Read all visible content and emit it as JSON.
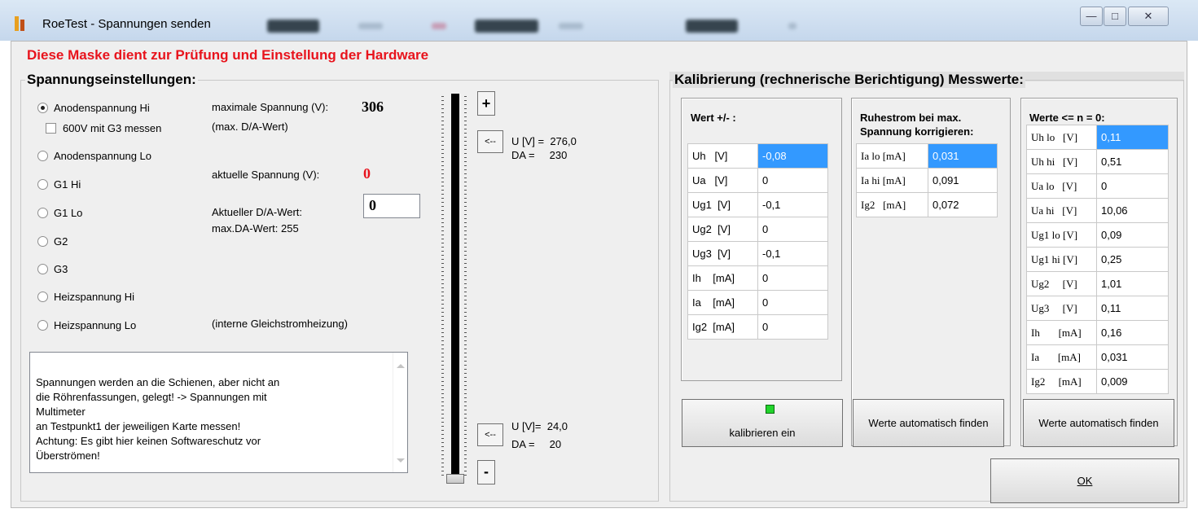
{
  "window": {
    "title": "RoeTest - Spannungen senden",
    "minimize_label": "—",
    "maximize_label": "□",
    "close_label": "✕"
  },
  "warning_text": "Diese Maske dient zur Prüfung und Einstellung der Hardware",
  "voltage_settings": {
    "legend": "Spannungseinstellungen:",
    "radio_options": [
      {
        "label": "Anodenspannung Hi",
        "selected": true
      },
      {
        "label": "Anodenspannung Lo",
        "selected": false
      },
      {
        "label": "G1 Hi",
        "selected": false
      },
      {
        "label": "G1 Lo",
        "selected": false
      },
      {
        "label": "G2",
        "selected": false
      },
      {
        "label": "G3",
        "selected": false
      },
      {
        "label": "Heizspannung Hi",
        "selected": false
      },
      {
        "label": "Heizspannung Lo",
        "selected": false
      }
    ],
    "checkbox_600v": {
      "label": "600V mit G3 messen",
      "checked": false
    },
    "max_voltage_label": "maximale Spannung (V):",
    "max_voltage_value": "306",
    "max_da_note": "(max. D/A-Wert)",
    "current_voltage_label": "aktuelle Spannung (V):",
    "current_voltage_value": "0",
    "current_da_label": "Aktueller D/A-Wert:",
    "current_da_value": "0",
    "max_da_value_label": "max.DA-Wert: 255",
    "heating_note": "(interne Gleichstromheizung)",
    "memo_text": "Spannungen werden an die Schienen, aber nicht an\ndie Röhrenfassungen, gelegt! -> Spannungen mit\nMultimeter\nan Testpunkt1 der jeweiligen Karte messen!\nAchtung: Es gibt hier keinen Softwareschutz vor\nÜberströmen!"
  },
  "slider": {
    "plus_label": "+",
    "minus_label": "-",
    "top_pointer_label": "<--",
    "top_u": "U [V] =  276,0",
    "top_da": "DA =     230",
    "bottom_pointer_label": "<--",
    "bottom_u": "U [V]=  24,0",
    "bottom_da": "DA =     20",
    "level_fraction": 0.0
  },
  "calibration": {
    "legend": "Kalibrierung (rechnerische Berichtigung) Messwerte:",
    "offset_panel": {
      "title": "Wert +/- :",
      "rows": [
        {
          "name": "Uh   [V]",
          "value": "-0,08",
          "selected": true
        },
        {
          "name": "Ua   [V]",
          "value": "0"
        },
        {
          "name": "Ug1  [V]",
          "value": "-0,1"
        },
        {
          "name": "Ug2  [V]",
          "value": "0"
        },
        {
          "name": "Ug3  [V]",
          "value": "-0,1"
        },
        {
          "name": "Ih    [mA]",
          "value": "0"
        },
        {
          "name": "Ia    [mA]",
          "value": "0"
        },
        {
          "name": "Ig2  [mA]",
          "value": "0"
        }
      ],
      "button_label": "kalibrieren ein",
      "led_color": "#22d42c"
    },
    "idle_panel": {
      "title_line1": "Ruhestrom bei max.",
      "title_line2": "Spannung korrigieren:",
      "rows": [
        {
          "name": "Ia lo [mA]",
          "value": "0,031",
          "selected": true
        },
        {
          "name": "Ia hi [mA]",
          "value": "0,091"
        },
        {
          "name": "Ig2   [mA]",
          "value": "0,072"
        }
      ],
      "button_label": "Werte automatisch finden"
    },
    "zero_panel": {
      "title": "Werte <= n = 0:",
      "rows": [
        {
          "name": "Uh lo   [V]",
          "value": "0,11",
          "selected": true
        },
        {
          "name": "Uh hi   [V]",
          "value": "0,51"
        },
        {
          "name": "Ua lo   [V]",
          "value": "0"
        },
        {
          "name": "Ua hi   [V]",
          "value": "10,06"
        },
        {
          "name": "Ug1 lo [V]",
          "value": "0,09"
        },
        {
          "name": "Ug1 hi [V]",
          "value": "0,25"
        },
        {
          "name": "Ug2     [V]",
          "value": "1,01"
        },
        {
          "name": "Ug3     [V]",
          "value": "0,11"
        },
        {
          "name": "Ih       [mA]",
          "value": "0,16"
        },
        {
          "name": "Ia       [mA]",
          "value": "0,031"
        },
        {
          "name": "Ig2     [mA]",
          "value": "0,009"
        }
      ],
      "button_label": "Werte automatisch finden"
    }
  },
  "ok_button": {
    "label": "OK"
  },
  "colors": {
    "warning": "#e8131c",
    "selection": "#3399ff",
    "led": "#22d42c"
  }
}
